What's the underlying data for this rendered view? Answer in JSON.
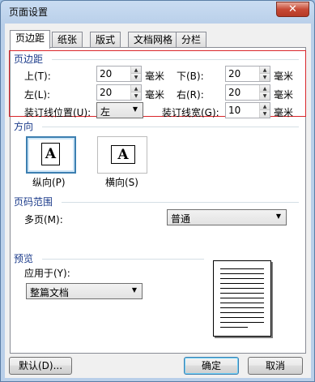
{
  "window": {
    "title": "页面设置",
    "close_glyph": "✕"
  },
  "tabs": [
    {
      "label": "页边距",
      "active": true
    },
    {
      "label": "纸张",
      "active": false
    },
    {
      "label": "版式",
      "active": false
    },
    {
      "label": "文档网格",
      "active": false
    },
    {
      "label": "分栏",
      "active": false
    }
  ],
  "margins": {
    "group_label": "页边距",
    "top": {
      "label": "上(T):",
      "value": "20",
      "unit": "毫米"
    },
    "bottom": {
      "label": "下(B):",
      "value": "20",
      "unit": "毫米"
    },
    "left": {
      "label": "左(L):",
      "value": "20",
      "unit": "毫米"
    },
    "right": {
      "label": "右(R):",
      "value": "20",
      "unit": "毫米"
    },
    "gutter_position": {
      "label": "装订线位置(U):",
      "value": "左"
    },
    "gutter": {
      "label": "装订线宽(G):",
      "value": "10",
      "unit": "毫米"
    }
  },
  "orientation": {
    "group_label": "方向",
    "portrait": {
      "label": "纵向(P)",
      "glyph": "A",
      "selected": true
    },
    "landscape": {
      "label": "横向(S)",
      "glyph": "A",
      "selected": false
    }
  },
  "page_range": {
    "group_label": "页码范围",
    "multiple_pages_label": "多页(M):",
    "multiple_pages_value": "普通"
  },
  "preview": {
    "group_label": "预览",
    "apply_to_label": "应用于(Y):",
    "apply_to_value": "整篇文档"
  },
  "buttons": {
    "default": "默认(D)...",
    "ok": "确定",
    "cancel": "取消"
  },
  "colors": {
    "highlight_box": "#d9262a",
    "selected_border": "#3c7fb1"
  }
}
